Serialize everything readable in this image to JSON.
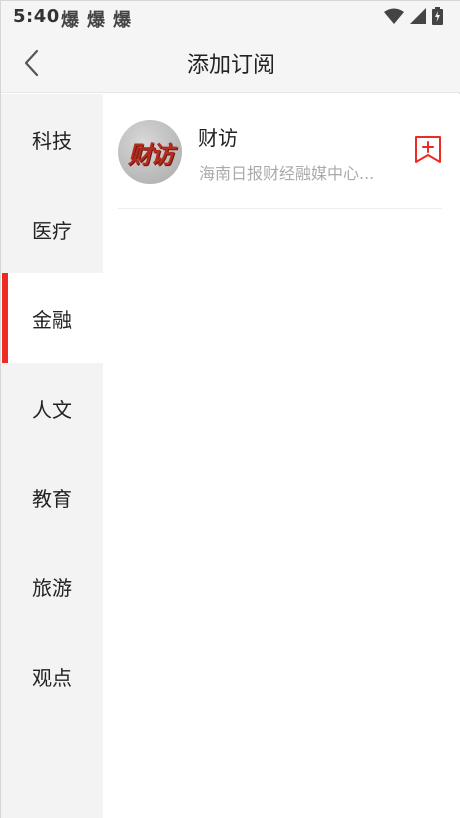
{
  "status_bar": {
    "time": "5:40",
    "notification_glyphs": [
      "爆",
      "爆",
      "爆"
    ],
    "icons": [
      "wifi-icon",
      "cell-signal-icon",
      "battery-charging-icon"
    ]
  },
  "header": {
    "title": "添加订阅",
    "back_icon": "chevron-left-icon"
  },
  "sidebar": {
    "active_index": 2,
    "items": [
      {
        "label": "科技"
      },
      {
        "label": "医疗"
      },
      {
        "label": "金融"
      },
      {
        "label": "人文"
      },
      {
        "label": "教育"
      },
      {
        "label": "旅游"
      },
      {
        "label": "观点"
      }
    ]
  },
  "subscriptions": [
    {
      "name": "财访",
      "description": "海南日报财经融媒中心...",
      "logo_text": "财访",
      "action_icon": "add-bookmark-icon"
    }
  ],
  "colors": {
    "accent": "#ee2a24",
    "sidebar_bg": "#f3f3f3",
    "header_bg": "#f5f5f5",
    "muted_text": "#aaaaaa"
  }
}
